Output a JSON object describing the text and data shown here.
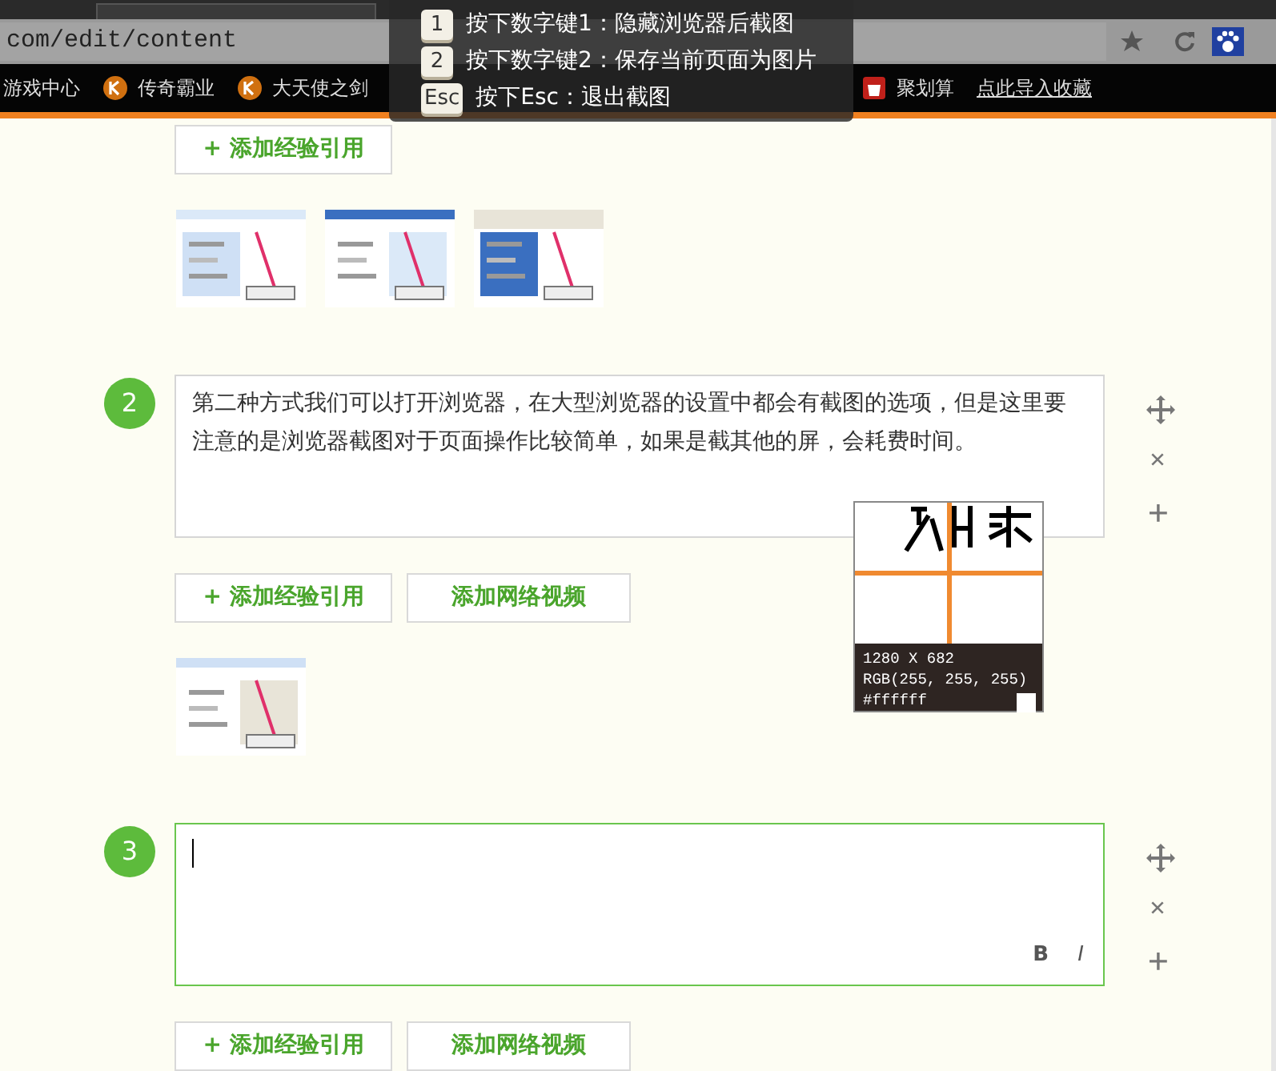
{
  "browser": {
    "address": "com/edit/content",
    "bookmarks": [
      {
        "label": "游戏中心",
        "kind": "plain"
      },
      {
        "label": "传奇霸业",
        "kind": "game"
      },
      {
        "label": "大天使之剑",
        "kind": "game"
      },
      {
        "label": "聚划算",
        "kind": "shop"
      },
      {
        "label": "点此导入收藏",
        "kind": "link"
      }
    ]
  },
  "capture_tip": {
    "items": [
      {
        "key": "1",
        "text": "按下数字键1：隐藏浏览器后截图"
      },
      {
        "key": "2",
        "text": "按下数字键2：保存当前页面为图片"
      },
      {
        "key": "Esc",
        "text": "按下Esc：退出截图"
      }
    ]
  },
  "steps": [
    {
      "buttons": [
        "+ 添加经验引用"
      ],
      "images": [
        {
          "kind": "picture"
        },
        {
          "kind": "picture"
        },
        {
          "kind": "picture"
        }
      ]
    },
    {
      "number": "2",
      "text": "第二种方式我们可以打开浏览器，在大型浏览器的设置中都会有截图的选项，但是这里要注意的是浏览器截图对于页面操作比较简单，如果是截其他的屏，会耗费时间。",
      "focused": false,
      "buttons": [
        "+ 添加经验引用",
        "添加网络视频"
      ],
      "images": [
        {
          "kind": "picture"
        }
      ]
    },
    {
      "number": "3",
      "focused": true,
      "format_buttons": [
        "B",
        "I"
      ],
      "buttons": [
        "+ 添加经验引用",
        "添加网络视频"
      ]
    }
  ],
  "magnifier": {
    "size": "1280 X 682",
    "rgb": "RGB(255, 255, 255)",
    "hex": "#ffffff",
    "color": "#ffffff"
  }
}
